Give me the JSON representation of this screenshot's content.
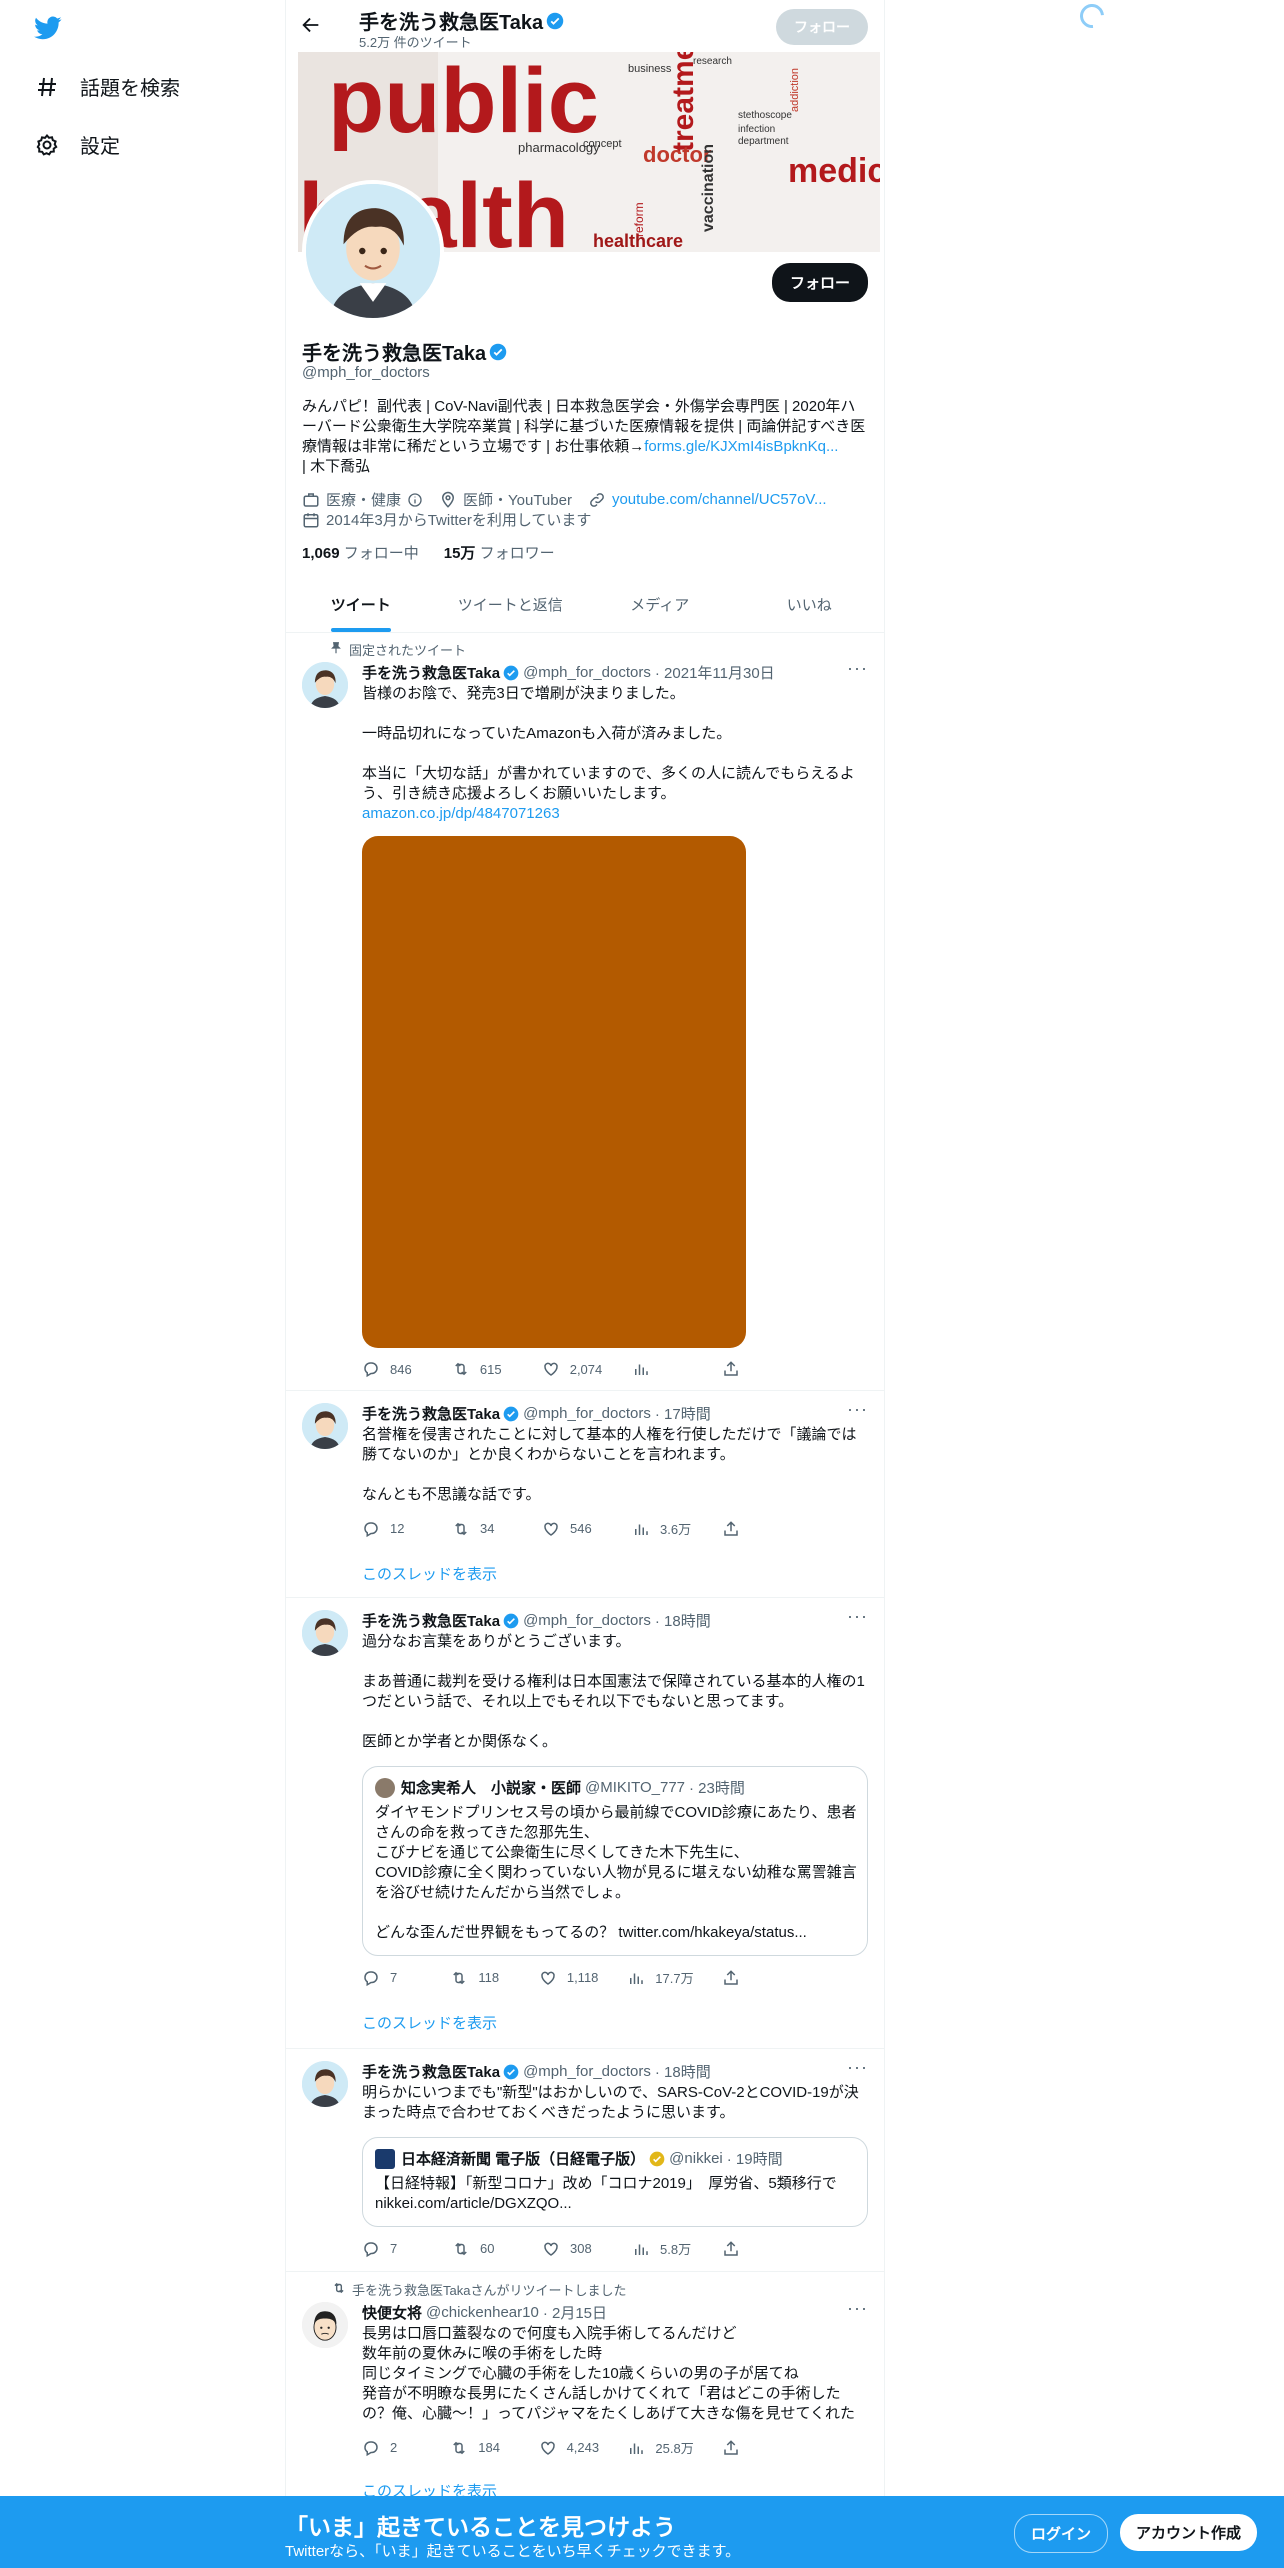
{
  "nav": {
    "explore_label": "話題を検索",
    "settings_label": "設定"
  },
  "profile": {
    "name": "手を洗う救急医Taka",
    "tweet_count": "5.2万 件のツイート",
    "follow_label": "フォロー",
    "handle": "@mph_for_doctors",
    "bio_text": "みんパピ！副代表 | CoV-Navi副代表 | 日本救急医学会・外傷学会専門医 | 2020年ハーバード公衆衛生大学院卒業賞 | 科学に基づいた医療情報を提供 | 両論併記すべき医療情報は非常に稀だという立場です | お仕事依頼→",
    "bio_link": "forms.gle/KJXmI4isBpknKq...",
    "bio_tail": "| 木下喬弘",
    "category": "医療・健康",
    "location": "医師・YouTuber",
    "website": "youtube.com/channel/UC57oV...",
    "joined": "2014年3月からTwitterを利用しています",
    "following_count": "1,069",
    "following_label": "フォロー中",
    "followers_count": "15万",
    "followers_label": "フォロワー"
  },
  "banner": {
    "words": [
      "public",
      "health",
      "medical",
      "treatment",
      "doctor",
      "healthcare",
      "pharmacology",
      "vaccination",
      "research",
      "business",
      "concept",
      "department",
      "infection",
      "addiction",
      "stethoscope",
      "reform"
    ]
  },
  "tabs": [
    "ツイート",
    "ツイートと返信",
    "メディア",
    "いいね"
  ],
  "tweets": [
    {
      "pinned_label": "固定されたツイート",
      "name": "手を洗う救急医Taka",
      "handle": "@mph_for_doctors",
      "time": "· 2021年11月30日",
      "text": "皆様のお陰で、発売3日で増刷が決まりました。\n\n一時品切れになっていたAmazonも入荷が済みました。\n\n本当に「大切な話」が書かれていますので、多くの人に読んでもらえるよう、引き続き応援よろしくお願いいたします。",
      "link": "amazon.co.jp/dp/4847071263",
      "image_color": "#b35a00",
      "replies": "846",
      "retweets": "615",
      "likes": "2,074"
    },
    {
      "name": "手を洗う救急医Taka",
      "handle": "@mph_for_doctors",
      "time": "· 17時間",
      "text": "名誉権を侵害されたことに対して基本的人権を行使しただけで「議論では勝てないのか」とか良くわからないことを言われます。\n\nなんとも不思議な話です。",
      "replies": "12",
      "retweets": "34",
      "likes": "546",
      "views": "3.6万",
      "thread_label": "このスレッドを表示"
    },
    {
      "name": "手を洗う救急医Taka",
      "handle": "@mph_for_doctors",
      "time": "· 18時間",
      "text": "過分なお言葉をありがとうございます。\n\nまあ普通に裁判を受ける権利は日本国憲法で保障されている基本的人権の1つだという話で、それ以上でもそれ以下でもないと思ってます。\n\n医師とか学者とか関係なく。",
      "quote": {
        "name": "知念実希人　小説家・医師",
        "handle": "@MIKITO_777",
        "time": "· 23時間",
        "text": "ダイヤモンドプリンセス号の頃から最前線でCOVID診療にあたり、患者さんの命を救ってきた忽那先生、\nこびナビを通じて公衆衛生に尽くしてきた木下先生に、\nCOVID診療に全く関わっていない人物が見るに堪えない幼稚な罵詈雑言を浴びせ続けたんだから当然でしょ。\n\nどんな歪んだ世界観をもってるの？ twitter.com/hkakeya/status..."
      },
      "replies": "7",
      "retweets": "118",
      "likes": "1,118",
      "views": "17.7万",
      "thread_label": "このスレッドを表示"
    },
    {
      "name": "手を洗う救急医Taka",
      "handle": "@mph_for_doctors",
      "time": "· 18時間",
      "text": "明らかにいつまでも\"新型\"はおかしいので、SARS-CoV-2とCOVID-19が決まった時点で合わせておくべきだったように思います。",
      "quote": {
        "name": "日本経済新聞 電子版（日経電子版）",
        "handle": "@nikkei",
        "time": "· 19時間",
        "text": "【日経特報】「新型コロナ」改め「コロナ2019」　厚労省、5類移行で\nnikkei.com/article/DGXZQO..."
      },
      "replies": "7",
      "retweets": "60",
      "likes": "308",
      "views": "5.8万"
    },
    {
      "retweet_label": "手を洗う救急医Takaさんがリツイートしました",
      "name": "快便女将",
      "handle": "@chickenhear10",
      "time": "· 2月15日",
      "text": "長男は口唇口蓋裂なので何度も入院手術してるんだけど\n数年前の夏休みに喉の手術をした時\n同じタイミングで心臓の手術をした10歳くらいの男の子が居てね\n発音が不明瞭な長男にたくさん話しかけてくれて「君はどこの手術したの？俺、心臓〜！」ってパジャマをたくしあげて大きな傷を見せてくれた",
      "replies": "2",
      "retweets": "184",
      "likes": "4,243",
      "views": "25.8万",
      "thread_label": "このスレッドを表示"
    }
  ],
  "bottom_bar": {
    "title": "「いま」起きていることを見つけよう",
    "subtitle": "Twitterなら、「いま」起きていることをいち早くチェックできます。",
    "login_label": "ログイン",
    "signup_label": "アカウント作成"
  },
  "colors": {
    "accent": "#1d9bf0",
    "text": "#0f1419",
    "secondary": "#536471"
  }
}
